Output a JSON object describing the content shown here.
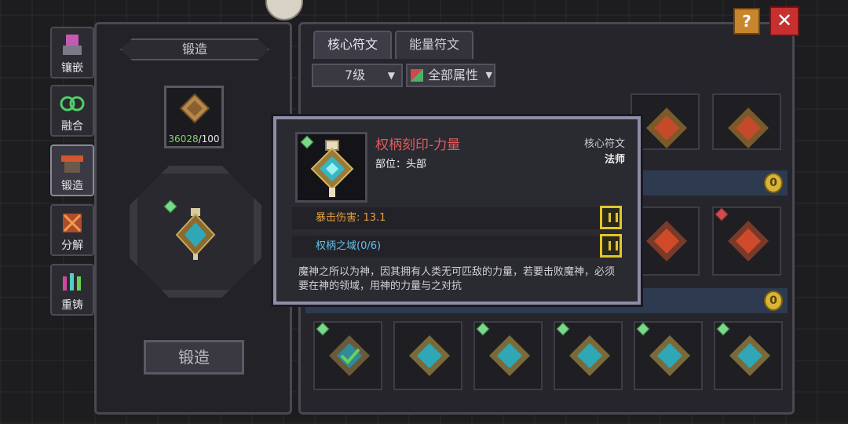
{
  "nav": {
    "items": [
      {
        "label": "镶嵌",
        "icon": "inlay-icon"
      },
      {
        "label": "融合",
        "icon": "fuse-icon"
      },
      {
        "label": "锻造",
        "icon": "forge-icon",
        "active": true
      },
      {
        "label": "分解",
        "icon": "decompose-icon"
      },
      {
        "label": "重铸",
        "icon": "recast-icon"
      }
    ]
  },
  "forge": {
    "title": "锻造",
    "material_have": "36028",
    "material_sep": "/",
    "material_need": "100",
    "button_label": "锻造"
  },
  "inventory": {
    "tabs": [
      {
        "label": "核心符文",
        "active": true
      },
      {
        "label": "能量符文",
        "active": false
      }
    ],
    "level_filter": "7级",
    "attribute_filter": "全部属性"
  },
  "tooltip": {
    "name": "权柄刻印-力量",
    "slot": "部位：头部",
    "category": "核心符文",
    "class": "法师",
    "stat": "暴击伤害: 13.1",
    "set_bonus": "权柄之域(0/6)",
    "description": "魔神之所以为神，因其拥有人类无可匹敌的力量，若要击败魔神，必须要在神的领域，用神的力量与之对抗"
  },
  "buttons": {
    "help": "?",
    "close": "✕",
    "coin": "0"
  },
  "colors": {
    "rune_name": "#e35b5b",
    "crit_stat": "#e6a23c",
    "set_bonus": "#63c1e8",
    "lock": "#e3c52c"
  }
}
